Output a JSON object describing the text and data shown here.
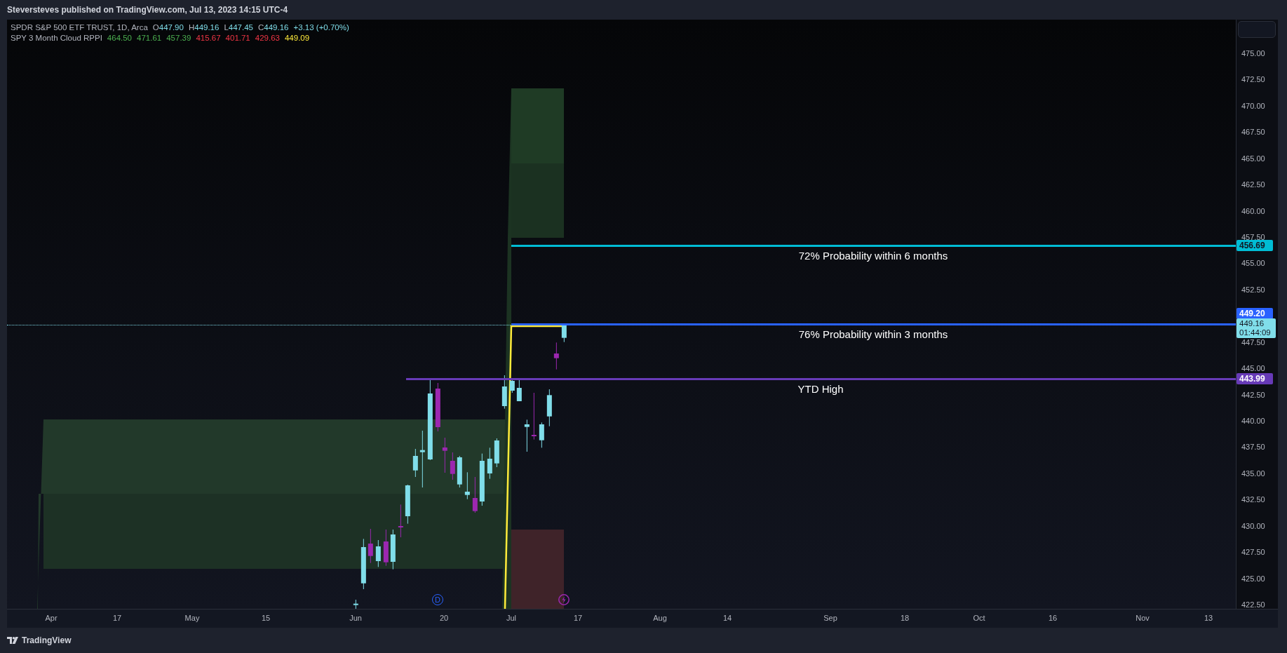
{
  "header": {
    "publish_line": "Steversteves published on TradingView.com, Jul 13, 2023 14:15 UTC-4"
  },
  "legend": {
    "symbol": "SPDR S&P 500 ETF TRUST, 1D, Arca",
    "ohlc": [
      {
        "key": "O",
        "value": "447.90"
      },
      {
        "key": "H",
        "value": "449.16"
      },
      {
        "key": "L",
        "value": "447.45"
      },
      {
        "key": "C",
        "value": "449.16"
      }
    ],
    "change": "+3.13 (+0.70%)"
  },
  "indicator": {
    "name": "SPY 3 Month Cloud RPPI",
    "values": [
      {
        "value": "464.50",
        "color": "#4caf50"
      },
      {
        "value": "471.61",
        "color": "#4caf50"
      },
      {
        "value": "457.39",
        "color": "#4caf50"
      },
      {
        "value": "415.67",
        "color": "#f23645"
      },
      {
        "value": "401.71",
        "color": "#f23645"
      },
      {
        "value": "429.63",
        "color": "#f23645"
      },
      {
        "value": "449.09",
        "color": "#ffeb3b"
      }
    ]
  },
  "levels": [
    {
      "label": "72% Probability within 6 months",
      "price_tag": "456.69",
      "color": "#00bcd4"
    },
    {
      "label": "76% Probability within 3 months",
      "price_tag": "449.20",
      "color": "#2962ff"
    },
    {
      "label": "YTD High",
      "price_tag": "443.99",
      "color": "#673ab7"
    }
  ],
  "last_price": {
    "value": "449.16",
    "countdown": "01:44:09"
  },
  "price_axis": [
    "475.00",
    "472.50",
    "470.00",
    "467.50",
    "465.00",
    "462.50",
    "460.00",
    "457.50",
    "455.00",
    "452.50",
    "447.50",
    "445.00",
    "442.50",
    "440.00",
    "437.50",
    "435.00",
    "432.50",
    "430.00",
    "427.50",
    "425.00",
    "422.50"
  ],
  "time_axis": [
    "Apr",
    "17",
    "May",
    "15",
    "Jun",
    "20",
    "Jul",
    "17",
    "Aug",
    "14",
    "Sep",
    "18",
    "Oct",
    "16",
    "Nov",
    "13"
  ],
  "markers": [
    {
      "kind": "dividend",
      "label": "D"
    },
    {
      "kind": "earnings"
    }
  ],
  "footer": {
    "brand": "TradingView"
  }
}
